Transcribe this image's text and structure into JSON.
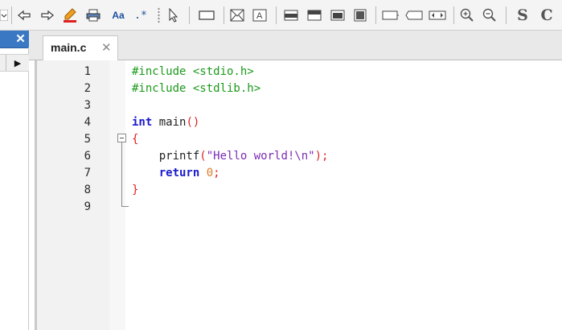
{
  "toolbar": {
    "items": [
      {
        "name": "dropdown-arrow-icon"
      },
      {
        "name": "back-arrow-icon"
      },
      {
        "name": "forward-arrow-icon"
      },
      {
        "name": "highlight-pen-icon"
      },
      {
        "name": "print-icon"
      },
      {
        "name": "match-case-icon",
        "label": "Aa"
      },
      {
        "name": "regex-icon",
        "label": ".*"
      },
      {
        "name": "select-cursor-icon"
      },
      {
        "name": "rectangle-icon"
      },
      {
        "name": "image-frame-icon"
      },
      {
        "name": "text-frame-icon"
      },
      {
        "name": "layout-1-icon"
      },
      {
        "name": "layout-2-icon"
      },
      {
        "name": "layout-3-icon"
      },
      {
        "name": "layout-4-icon"
      },
      {
        "name": "shape-1-icon"
      },
      {
        "name": "shape-2-icon"
      },
      {
        "name": "shape-3-icon"
      },
      {
        "name": "zoom-in-icon"
      },
      {
        "name": "zoom-out-icon"
      }
    ],
    "s_label": "S",
    "c_label": "C"
  },
  "left_panel": {
    "close_label": "✕",
    "arrow_label": "▶"
  },
  "tabs": [
    {
      "label": "main.c",
      "close_label": "✕"
    }
  ],
  "editor": {
    "lines": [
      {
        "num": "1"
      },
      {
        "num": "2"
      },
      {
        "num": "3"
      },
      {
        "num": "4"
      },
      {
        "num": "5"
      },
      {
        "num": "6"
      },
      {
        "num": "7"
      },
      {
        "num": "8"
      },
      {
        "num": "9"
      }
    ],
    "code": {
      "l1": "#include <stdio.h>",
      "l2": "#include <stdlib.h>",
      "l4_kw": "int",
      "l4_fn": " main",
      "l4_par": "()",
      "l5": "{",
      "l6_fn": "    printf",
      "l6_open": "(",
      "l6_str": "\"Hello world!\\n\"",
      "l6_close": ");",
      "l7_kw": "    return",
      "l7_num": " 0",
      "l7_end": ";",
      "l8": "}"
    }
  },
  "colors": {
    "panel_blue": "#3b78c4",
    "preprocessor": "#1b9a1b",
    "keyword": "#1a1acc",
    "string": "#7b2bb5",
    "paren": "#e02020",
    "number": "#e07a2a"
  }
}
